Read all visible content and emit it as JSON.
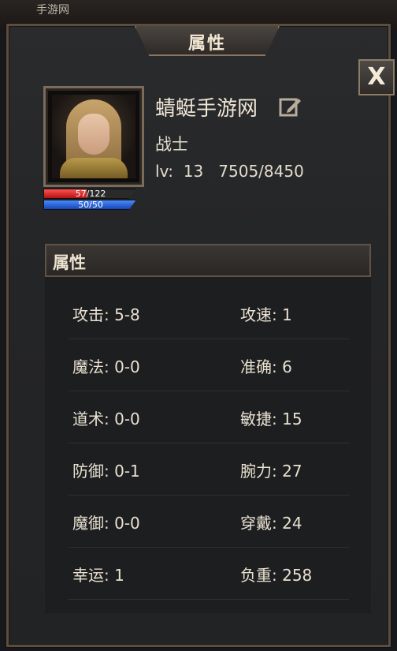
{
  "background": {
    "top_left_text": "手游网"
  },
  "window": {
    "title": "属性",
    "close_label": "X"
  },
  "character": {
    "name": "蜻蜓手游网",
    "class": "战士",
    "level_line": "lv:  13   7505/8450",
    "hp": {
      "text": "57/122",
      "current": 57,
      "max": 122
    },
    "mp": {
      "text": "50/50",
      "current": 50,
      "max": 50
    }
  },
  "section": {
    "title": "属性"
  },
  "stats": [
    {
      "left": "攻击: 5-8",
      "right": "攻速: 1"
    },
    {
      "left": "魔法: 0-0",
      "right": "准确: 6"
    },
    {
      "left": "道术: 0-0",
      "right": "敏捷: 15"
    },
    {
      "left": "防御: 0-1",
      "right": "腕力: 27"
    },
    {
      "left": "魔御: 0-0",
      "right": "穿戴: 24"
    },
    {
      "left": "幸运: 1",
      "right": "负重: 258"
    }
  ],
  "colors": {
    "hp": "#d42020",
    "mp": "#2a64d8",
    "frame": "#8a7660"
  }
}
